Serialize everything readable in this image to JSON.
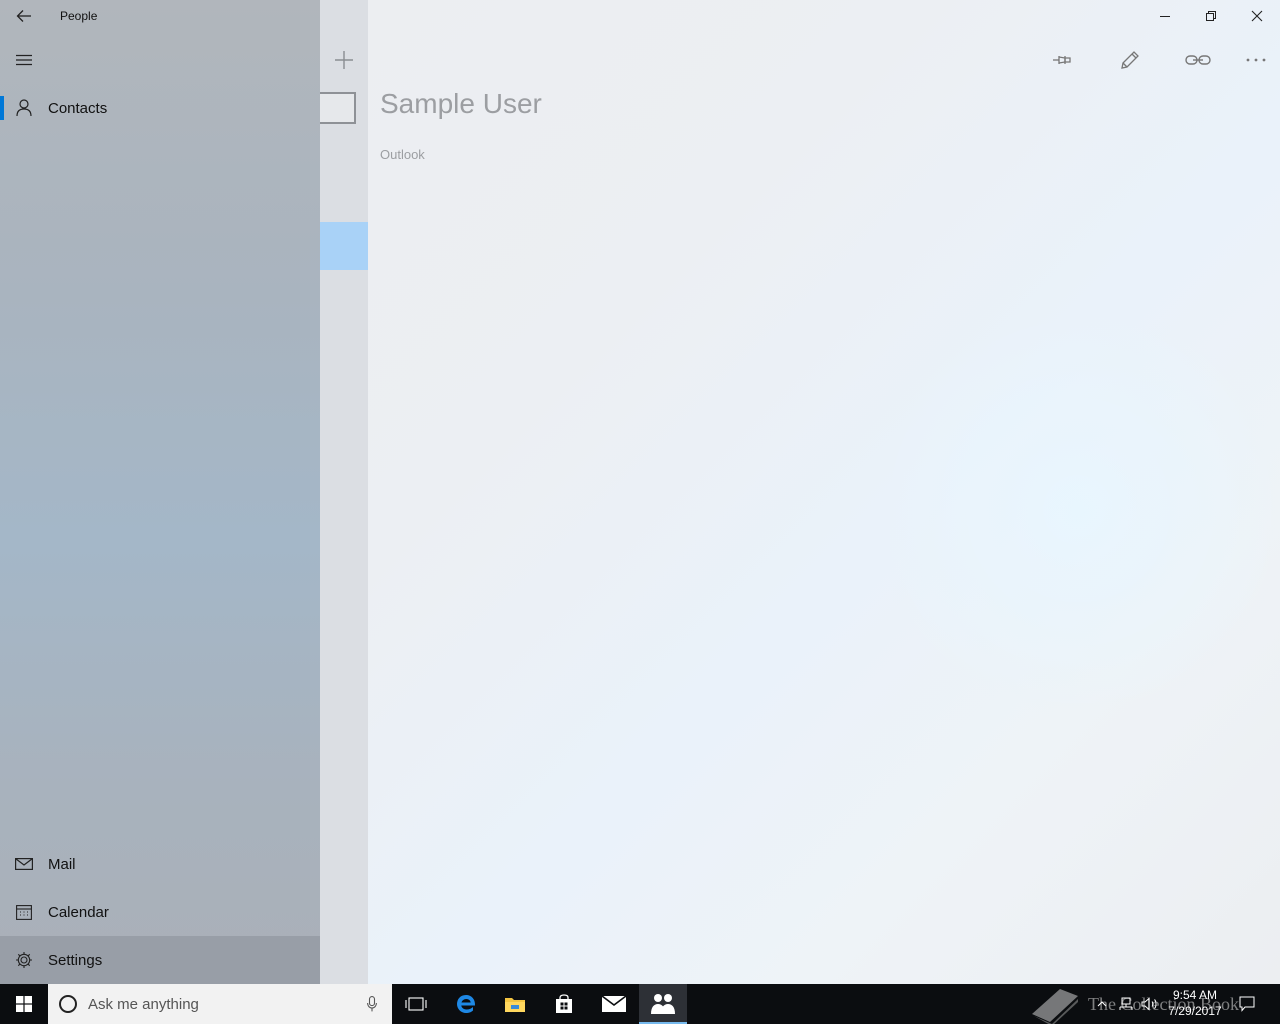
{
  "window": {
    "title": "People"
  },
  "nav": {
    "items": [
      {
        "label": "Contacts",
        "icon": "person-icon",
        "active": true
      },
      {
        "label": "Mail",
        "icon": "mail-icon"
      },
      {
        "label": "Calendar",
        "icon": "calendar-icon"
      },
      {
        "label": "Settings",
        "icon": "gear-icon"
      }
    ]
  },
  "contact": {
    "name": "Sample User",
    "source": "Outlook"
  },
  "toolbar": {
    "icons": [
      "pin-icon",
      "edit-icon",
      "link-icon",
      "more-icon"
    ]
  },
  "taskbar": {
    "search_placeholder": "Ask me anything",
    "time": "9:54 AM",
    "date": "7/29/2017",
    "watermark": "The Collection Book",
    "apps": [
      "task-view-icon",
      "edge-icon",
      "file-explorer-icon",
      "store-icon",
      "mail-icon",
      "people-icon"
    ]
  },
  "colors": {
    "accent": "#0078d7",
    "selection": "#a9d2f7",
    "taskbar": "#0b0d10"
  }
}
